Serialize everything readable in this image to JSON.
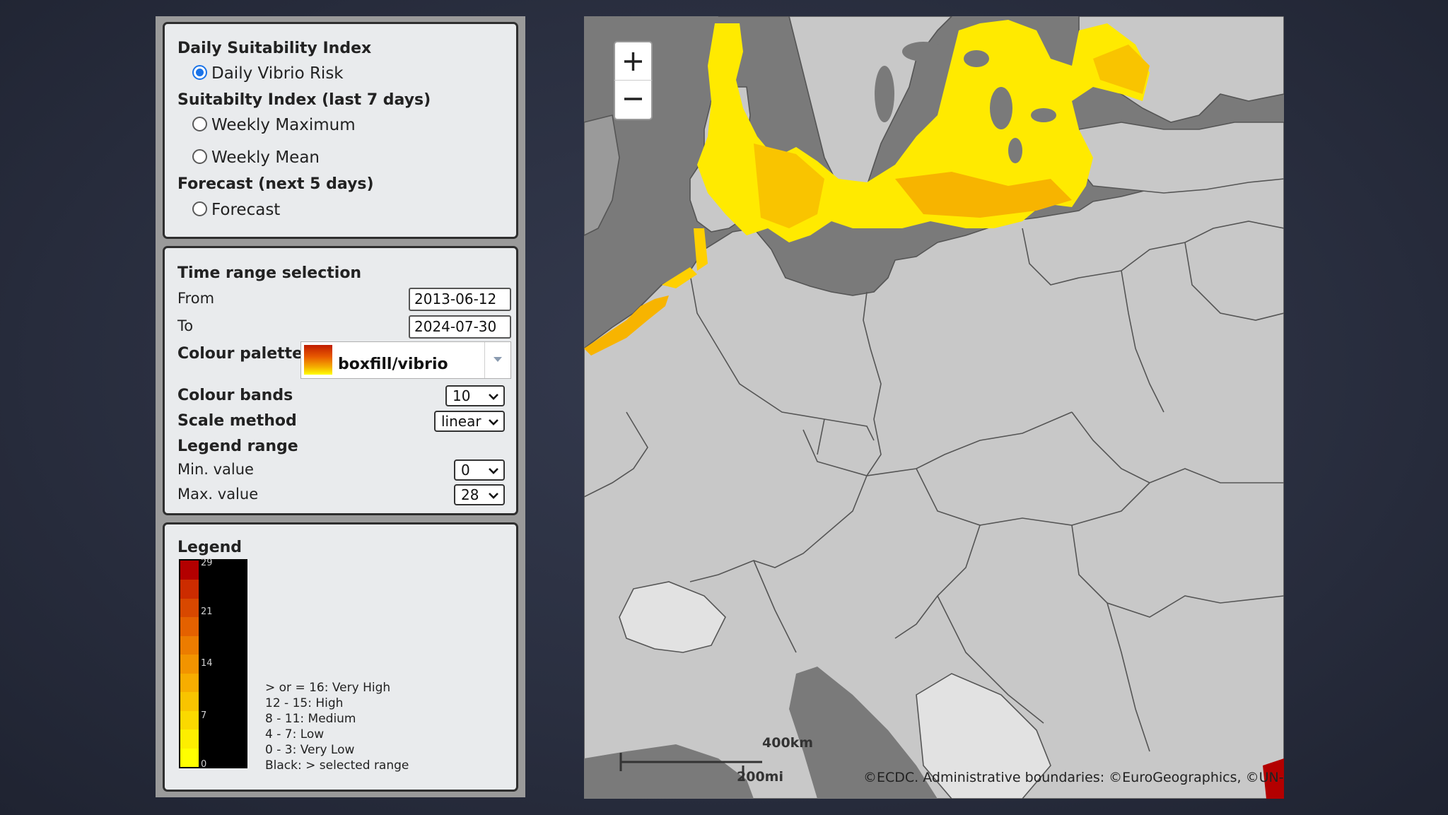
{
  "layers": {
    "daily_heading": "Daily Suitability Index",
    "daily_risk": "Daily Vibrio Risk",
    "weekly_heading": "Suitabilty Index (last 7 days)",
    "weekly_max": "Weekly Maximum",
    "weekly_mean": "Weekly Mean",
    "forecast_heading": "Forecast (next 5 days)",
    "forecast": "Forecast",
    "selected": "Daily Vibrio Risk"
  },
  "settings": {
    "heading": "Time range selection",
    "from_label": "From",
    "from_value": "2013-06-12",
    "to_label": "To",
    "to_value": "2024-07-30",
    "palette_label": "Colour palette",
    "palette_value": "boxfill/vibrio",
    "bands_label": "Colour bands",
    "bands_value": "10",
    "scale_label": "Scale method",
    "scale_value": "linear",
    "range_heading": "Legend range",
    "min_label": "Min. value",
    "min_value": "0",
    "max_label": "Max. value",
    "max_value": "28"
  },
  "legend": {
    "title": "Legend",
    "ticks": [
      "29",
      "21",
      "14",
      "7",
      "0"
    ],
    "lines": [
      "> or = 16: Very High",
      "12 - 15: High",
      "8 - 11: Medium",
      "4 - 7: Low",
      "0 - 3: Very Low",
      "Black: > selected range"
    ],
    "colors": [
      "#b30000",
      "#cc2c00",
      "#d84800",
      "#e46100",
      "#ec7c00",
      "#f29400",
      "#f7ad00",
      "#f9c400",
      "#fbd900",
      "#fdee00",
      "#ffff00"
    ]
  },
  "map": {
    "zoom_in": "+",
    "zoom_out": "−",
    "scale_km": "400km",
    "scale_mi": "200mi",
    "attribution": "©ECDC. Administrative boundaries: ©EuroGeographics, ©UN-FAO",
    "colors": {
      "sea": "#7a7a7a",
      "land": "#c8c8c8",
      "border": "#555555",
      "risk_high": "#f9c400",
      "risk_low": "#ffff00"
    }
  }
}
